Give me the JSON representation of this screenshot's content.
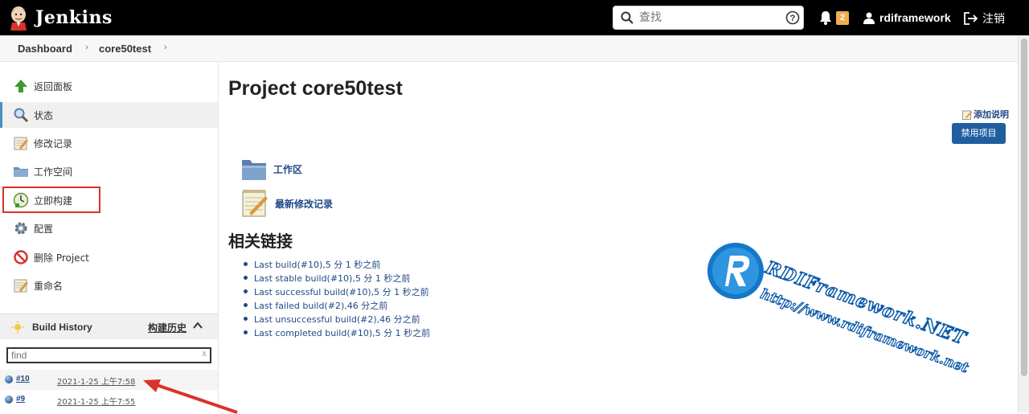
{
  "header": {
    "app_title": "Jenkins",
    "search_placeholder": "查找",
    "notification_count": "2",
    "username": "rdiframework",
    "logout_label": "注销"
  },
  "breadcrumb": {
    "items": [
      "Dashboard",
      "core50test"
    ]
  },
  "sidebar": {
    "items": [
      {
        "label": "返回面板",
        "icon": "up-arrow-icon"
      },
      {
        "label": "状态",
        "icon": "search-icon"
      },
      {
        "label": "修改记录",
        "icon": "notepad-icon"
      },
      {
        "label": "工作空间",
        "icon": "folder-icon"
      },
      {
        "label": "立即构建",
        "icon": "build-clock-icon"
      },
      {
        "label": "配置",
        "icon": "gear-icon"
      },
      {
        "label": "删除 Project",
        "icon": "no-entry-icon"
      },
      {
        "label": "重命名",
        "icon": "notepad-icon"
      }
    ]
  },
  "build_history": {
    "title": "Build History",
    "trend_link": "构建历史",
    "filter_placeholder": "find",
    "clear_label": "x",
    "builds": [
      {
        "number": "#10",
        "date": "2021-1-25 上午7:58"
      },
      {
        "number": "#9",
        "date": "2021-1-25 上午7:55"
      }
    ]
  },
  "main": {
    "title": "Project core50test",
    "add_description": "添加说明",
    "disable_button": "禁用项目",
    "workspace_label": "工作区",
    "changelog_label": "最新修改记录",
    "related_title": "相关链接",
    "related_links": [
      "Last build(#10),5 分 1 秒之前",
      "Last stable build(#10),5 分 1 秒之前",
      "Last successful build(#10),5 分 1 秒之前",
      "Last failed build(#2),46 分之前",
      "Last unsuccessful build(#2),46 分之前",
      "Last completed build(#10),5 分 1 秒之前"
    ]
  },
  "watermark": {
    "brand": "RDIFramework.NET",
    "url": "http://www.rdiframework.net"
  },
  "colors": {
    "topbar": "#000000",
    "link": "#204a87",
    "button": "#1f5fa0",
    "badge": "#f0ad4e",
    "highlight": "#d9322a"
  }
}
